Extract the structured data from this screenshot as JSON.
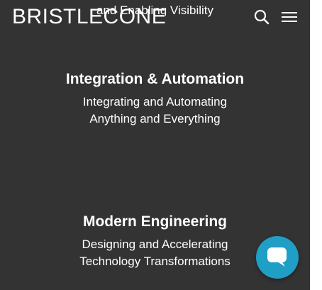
{
  "header": {
    "logo_text": "BRISTLECONE",
    "search_icon": "search-icon",
    "menu_icon": "hamburger-menu-icon"
  },
  "top_fragment": "and Enabling Visibility",
  "sections": [
    {
      "title": "Integration & Automation",
      "lines": [
        "Integrating and Automating",
        "Anything and Everything"
      ]
    },
    {
      "title": "Modern Engineering",
      "lines": [
        "Designing and Accelerating",
        "Technology Transformations"
      ]
    }
  ],
  "chat": {
    "icon": "chat-bubble-icon",
    "color": "#1f9ec6"
  },
  "colors": {
    "background": "#333333",
    "text": "#ffffff"
  }
}
